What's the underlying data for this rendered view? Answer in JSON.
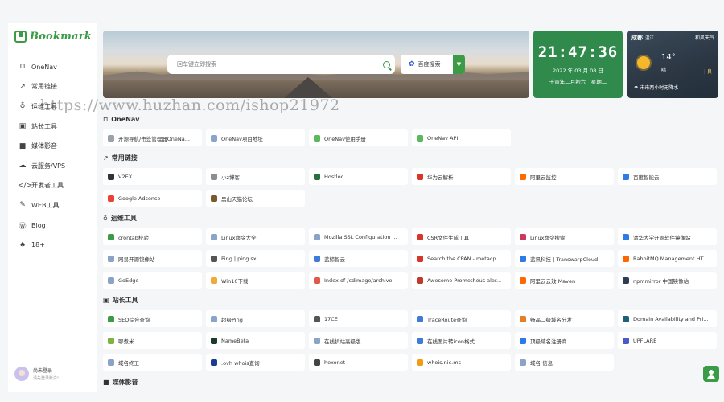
{
  "sidebar": {
    "logo": "Bookmark",
    "items": [
      {
        "label": "OneNav",
        "icon": "bookmark-icon",
        "glyph": "⊓"
      },
      {
        "label": "常用链接",
        "icon": "external-link-icon",
        "glyph": "↗"
      },
      {
        "label": "运维工具",
        "icon": "flask-icon",
        "glyph": "♁"
      },
      {
        "label": "站长工具",
        "icon": "shield-icon",
        "glyph": "▣"
      },
      {
        "label": "媒体影音",
        "icon": "video-icon",
        "glyph": "■"
      },
      {
        "label": "云服务/VPS",
        "icon": "cloud-icon",
        "glyph": "☁"
      },
      {
        "label": "开发者工具",
        "icon": "code-icon",
        "glyph": "</>"
      },
      {
        "label": "WEB工具",
        "icon": "wrench-icon",
        "glyph": "✎"
      },
      {
        "label": "Blog",
        "icon": "wordpress-icon",
        "glyph": "Ⓦ"
      },
      {
        "label": "18+",
        "icon": "person-icon",
        "glyph": "♠"
      }
    ],
    "user": {
      "name": "尚未登录",
      "sub": "请先登录账户!"
    }
  },
  "search": {
    "placeholder": "回车键立即搜索",
    "engine": "百度搜索"
  },
  "clock": {
    "time": "21:47:36",
    "date": "2022 年 03 月 08 日",
    "lunar": "壬寅年二月初六　星期二"
  },
  "weather": {
    "city": "成都",
    "district": "温江",
    "source": "和风天气",
    "temp": "14°",
    "condition": "晴",
    "aqi": "| 良",
    "forecast": "未来两小时无降水"
  },
  "watermark": "https://www.huzhan.com/ishop21972",
  "sections": [
    {
      "title": "OneNav",
      "icon": "bookmark-icon",
      "glyph": "⊓",
      "cards": [
        {
          "label": "开源导航/书签管理器OneNa...",
          "color": "#9aa3ab"
        },
        {
          "label": "OneNav项目地址",
          "color": "#8aa3c8"
        },
        {
          "label": "OneNav使用手册",
          "color": "#5bb85c"
        },
        {
          "label": "OneNav API",
          "color": "#5bb85c"
        }
      ]
    },
    {
      "title": "常用链接",
      "icon": "external-link-icon",
      "glyph": "↗",
      "cards": [
        {
          "label": "V2EX",
          "color": "#333333"
        },
        {
          "label": "小z博客",
          "color": "#8d8d8d"
        },
        {
          "label": "Hostloc",
          "color": "#2a6f3e"
        },
        {
          "label": "华为云解析",
          "color": "#d9342a"
        },
        {
          "label": "阿里云监控",
          "color": "#ff6a00"
        },
        {
          "label": "百度智能云",
          "color": "#2f7be5"
        },
        {
          "label": "Google Adsense",
          "color": "#ea4335"
        },
        {
          "label": "黑山天猫论坛",
          "color": "#7a5a2a"
        }
      ]
    },
    {
      "title": "运维工具",
      "icon": "flask-icon",
      "glyph": "♁",
      "cards": [
        {
          "label": "crontab校验",
          "color": "#3c9b46"
        },
        {
          "label": "Linux命令大全",
          "color": "#8aa3c8"
        },
        {
          "label": "Mozilla SSL Configuration ...",
          "color": "#8aa3c8"
        },
        {
          "label": "CSR文件生成工具",
          "color": "#d9342a"
        },
        {
          "label": "Linux命令搜索",
          "color": "#c93a5a"
        },
        {
          "label": "清华大学开源软件镜像站",
          "color": "#2f7be5"
        },
        {
          "label": "网易开源镜像站",
          "color": "#8aa3c8"
        },
        {
          "label": "Ping | ping.sx",
          "color": "#555555"
        },
        {
          "label": "蓝鲸智云",
          "color": "#3d7dd8"
        },
        {
          "label": "Search the CPAN - metacp...",
          "color": "#d9342a"
        },
        {
          "label": "蓝讯科技 | TranswarpCloud",
          "color": "#2f7be5"
        },
        {
          "label": "RabbitMQ Management HT...",
          "color": "#ff6600"
        },
        {
          "label": "GoEdge",
          "color": "#8aa3c8"
        },
        {
          "label": "Win10下载",
          "color": "#f2a93b"
        },
        {
          "label": "Index of /cdimage/archive",
          "color": "#e05a4a"
        },
        {
          "label": "Awesome Prometheus aler...",
          "color": "#c0392b"
        },
        {
          "label": "阿里云云效 Maven",
          "color": "#ff6a00"
        },
        {
          "label": "npmmirror 中国镜像站",
          "color": "#2c3e50"
        }
      ]
    },
    {
      "title": "站长工具",
      "icon": "shield-icon",
      "glyph": "▣",
      "cards": [
        {
          "label": "SEO综合查询",
          "color": "#3c9b46"
        },
        {
          "label": "超级Ping",
          "color": "#8aa3c8"
        },
        {
          "label": "17CE",
          "color": "#555555"
        },
        {
          "label": "TraceRoute查询",
          "color": "#3d7dd8"
        },
        {
          "label": "畅晶二级域名分发",
          "color": "#e67e22"
        },
        {
          "label": "Domain Availability and Pri...",
          "color": "#1f5f7a"
        },
        {
          "label": "哪煮米",
          "color": "#7cb342"
        },
        {
          "label": "NameBeta",
          "color": "#1d3b2a"
        },
        {
          "label": "在线扒站高级版",
          "color": "#8aa3c8"
        },
        {
          "label": "在线图片转icon格式",
          "color": "#3d7dd8"
        },
        {
          "label": "顶级域名注册商",
          "color": "#2f7be5"
        },
        {
          "label": "UPFLARE",
          "color": "#4a5ac8"
        },
        {
          "label": "域名终工",
          "color": "#8aa3c8"
        },
        {
          "label": ".ovh whois查询",
          "color": "#1a3d8f"
        },
        {
          "label": "hexonet",
          "color": "#444444"
        },
        {
          "label": "whois.nic.ms",
          "color": "#f39c12"
        },
        {
          "label": "域名 信息",
          "color": "#8aa3c8"
        }
      ]
    },
    {
      "title": "媒体影音",
      "icon": "video-icon",
      "glyph": "■",
      "cards": []
    }
  ]
}
